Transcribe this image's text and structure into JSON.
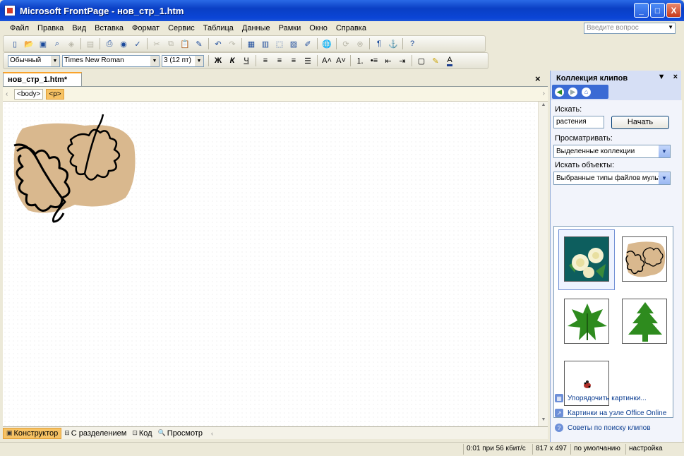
{
  "window": {
    "title": "Microsoft FrontPage - нов_стр_1.htm",
    "controls": [
      "_",
      "□",
      "X"
    ]
  },
  "menu": {
    "items": [
      "Файл",
      "Правка",
      "Вид",
      "Вставка",
      "Формат",
      "Сервис",
      "Таблица",
      "Данные",
      "Рамки",
      "Окно",
      "Справка"
    ],
    "ask_placeholder": "Введите вопрос"
  },
  "format_toolbar": {
    "style": "Обычный",
    "font": "Times New Roman",
    "size": "3 (12 пт)",
    "bold": "Ж",
    "italic": "К",
    "underline": "Ч"
  },
  "document": {
    "tab_label": "нов_стр_1.htm*",
    "close": "×",
    "tags": [
      "<body>",
      "<p>"
    ]
  },
  "view_tabs": [
    "Конструктор",
    "С разделением",
    "Код",
    "Просмотр"
  ],
  "task_pane": {
    "title": "Коллекция клипов",
    "search_label": "Искать:",
    "search_value": "растения",
    "start_button": "Начать",
    "browse_label": "Просматривать:",
    "browse_value": "Выделенные коллекции",
    "find_objects_label": "Искать объекты:",
    "find_objects_value": "Выбранные типы файлов мульт",
    "clips": [
      "roses-clip",
      "leaves-clip",
      "green-leaf-clip",
      "tree-clip",
      "ladybug-clip"
    ],
    "links": [
      "Упорядочить картинки...",
      "Картинки на узле Office Online",
      "Советы по поиску клипов"
    ]
  },
  "status": {
    "speed": "0:01 при 56 кбит/с",
    "dimensions": "817 x 497",
    "mode": "по умолчанию",
    "settings": "настройка"
  },
  "colors": {
    "clip_background": "#d9b88e",
    "title_bar": "#0a3fc4",
    "highlight": "#f6c264",
    "leaf_green": "#2e8b1e"
  }
}
